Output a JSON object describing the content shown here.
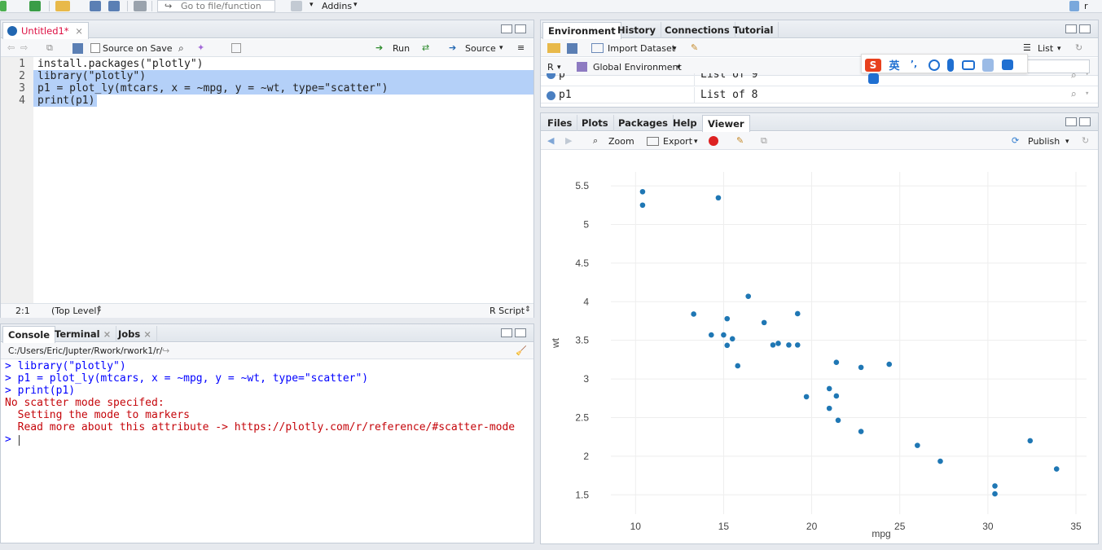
{
  "toolbar": {
    "goto_placeholder": "Go to file/function",
    "addins_label": "Addins",
    "project_label": "r"
  },
  "source": {
    "tab_label": "Untitled1*",
    "source_on_save_label": "Source on Save",
    "run_label": "Run",
    "source_label": "Source",
    "lines": [
      {
        "n": "1",
        "text": "install.packages(\"plotly\")"
      },
      {
        "n": "2",
        "text": "library(\"plotly\")"
      },
      {
        "n": "3",
        "text": "p1 = plot_ly(mtcars, x = ~mpg, y = ~wt, type=\"scatter\")"
      },
      {
        "n": "4",
        "text": "print(p1)"
      }
    ],
    "status_position": "2:1",
    "status_scope": "(Top Level)",
    "status_type": "R Script"
  },
  "console": {
    "tabs": [
      "Console",
      "Terminal",
      "Jobs"
    ],
    "path": "C:/Users/Eric/Jupter/Rwork/rwork1/r/",
    "lines": [
      {
        "text": "> library(\"plotly\")",
        "kind": "input"
      },
      {
        "text": "> p1 = plot_ly(mtcars, x = ~mpg, y = ~wt, type=\"scatter\")",
        "kind": "input"
      },
      {
        "text": "> print(p1)",
        "kind": "input"
      },
      {
        "text": "No scatter mode specifed:",
        "kind": "msg"
      },
      {
        "text": "  Setting the mode to markers",
        "kind": "msg"
      },
      {
        "text": "  Read more about this attribute -> https://plotly.com/r/reference/#scatter-mode",
        "kind": "msg"
      },
      {
        "text": "> ",
        "kind": "prompt"
      }
    ]
  },
  "environment": {
    "tabs": [
      "Environment",
      "History",
      "Connections",
      "Tutorial"
    ],
    "import_label": "Import Dataset",
    "list_label": "List",
    "lang_label": "R",
    "scope_label": "Global Environment",
    "rows": [
      {
        "name": "p",
        "value": "List of  9"
      },
      {
        "name": "p1",
        "value": "List of  8"
      }
    ],
    "ime": {
      "badge": "S",
      "lang": "英"
    }
  },
  "viewer": {
    "tabs": [
      "Files",
      "Plots",
      "Packages",
      "Help",
      "Viewer"
    ],
    "zoom_label": "Zoom",
    "export_label": "Export",
    "publish_label": "Publish"
  },
  "chart_data": {
    "type": "scatter",
    "xlabel": "mpg",
    "ylabel": "wt",
    "xlim": [
      8.6,
      35.6
    ],
    "ylim": [
      1.25,
      5.68
    ],
    "xticks": [
      10,
      15,
      20,
      25,
      30,
      35
    ],
    "yticks": [
      1.5,
      2,
      2.5,
      3,
      3.5,
      4,
      4.5,
      5,
      5.5
    ],
    "x": [
      21.0,
      21.0,
      22.8,
      21.4,
      18.7,
      18.1,
      14.3,
      24.4,
      22.8,
      19.2,
      17.8,
      16.4,
      17.3,
      15.2,
      10.4,
      10.4,
      14.7,
      32.4,
      30.4,
      33.9,
      21.5,
      15.5,
      15.2,
      13.3,
      19.2,
      27.3,
      26.0,
      30.4,
      15.8,
      19.7,
      15.0,
      21.4
    ],
    "y": [
      2.62,
      2.875,
      2.32,
      3.215,
      3.44,
      3.46,
      3.57,
      3.19,
      3.15,
      3.44,
      3.44,
      4.07,
      3.73,
      3.78,
      5.25,
      5.424,
      5.345,
      2.2,
      1.615,
      1.835,
      2.465,
      3.52,
      3.435,
      3.84,
      3.845,
      1.935,
      2.14,
      1.513,
      3.17,
      2.77,
      3.57,
      2.78
    ],
    "marker_color": "#1f77b4",
    "grid": true
  }
}
